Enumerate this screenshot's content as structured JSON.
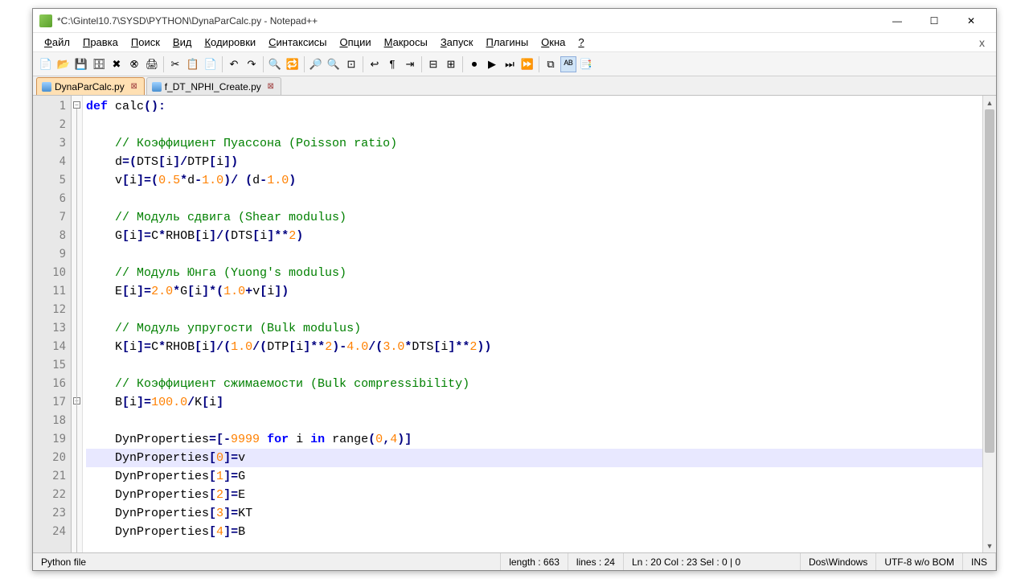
{
  "title": "*C:\\Gintel10.7\\SYSD\\PYTHON\\DynaParCalc.py - Notepad++",
  "menu": [
    "Файл",
    "Правка",
    "Поиск",
    "Вид",
    "Кодировки",
    "Синтаксисы",
    "Опции",
    "Макросы",
    "Запуск",
    "Плагины",
    "Окна",
    "?"
  ],
  "tabs": [
    {
      "name": "DynaParCalc.py",
      "active": true
    },
    {
      "name": "f_DT_NPHI_Create.py",
      "active": false
    }
  ],
  "gutter_lines": 24,
  "current_line_idx": 19,
  "status": {
    "filetype": "Python file",
    "length": "length : 663",
    "lines": "lines : 24",
    "pos": "Ln : 20    Col : 23    Sel : 0 | 0",
    "eol": "Dos\\Windows",
    "enc": "UTF-8 w/o BOM",
    "ovr": "INS"
  },
  "code": [
    {
      "t": "def",
      "h": [
        [
          "kw",
          "def "
        ],
        [
          "fn",
          "calc"
        ],
        [
          "op",
          "():"
        ]
      ]
    },
    {
      "t": ""
    },
    {
      "t": "c",
      "h": [
        [
          "id",
          "    "
        ],
        [
          "cm",
          "// Коэффициент Пуассона (Poisson ratio)"
        ]
      ]
    },
    {
      "t": "",
      "h": [
        [
          "id",
          "    d"
        ],
        [
          "op",
          "=("
        ],
        [
          "id",
          "DTS"
        ],
        [
          "op",
          "["
        ],
        [
          "id",
          "i"
        ],
        [
          "op",
          "]/"
        ],
        [
          "id",
          "DTP"
        ],
        [
          "op",
          "["
        ],
        [
          "id",
          "i"
        ],
        [
          "op",
          "])"
        ]
      ]
    },
    {
      "t": "",
      "h": [
        [
          "id",
          "    v"
        ],
        [
          "op",
          "["
        ],
        [
          "id",
          "i"
        ],
        [
          "op",
          "]=("
        ],
        [
          "num",
          "0.5"
        ],
        [
          "op",
          "*"
        ],
        [
          "id",
          "d"
        ],
        [
          "op",
          "-"
        ],
        [
          "num",
          "1.0"
        ],
        [
          "op",
          ")/ ("
        ],
        [
          "id",
          "d"
        ],
        [
          "op",
          "-"
        ],
        [
          "num",
          "1.0"
        ],
        [
          "op",
          ")"
        ]
      ]
    },
    {
      "t": ""
    },
    {
      "t": "c",
      "h": [
        [
          "id",
          "    "
        ],
        [
          "cm",
          "// Модуль сдвига (Shear modulus)"
        ]
      ]
    },
    {
      "t": "",
      "h": [
        [
          "id",
          "    G"
        ],
        [
          "op",
          "["
        ],
        [
          "id",
          "i"
        ],
        [
          "op",
          "]="
        ],
        [
          "id",
          "C"
        ],
        [
          "op",
          "*"
        ],
        [
          "id",
          "RHOB"
        ],
        [
          "op",
          "["
        ],
        [
          "id",
          "i"
        ],
        [
          "op",
          "]/("
        ],
        [
          "id",
          "DTS"
        ],
        [
          "op",
          "["
        ],
        [
          "id",
          "i"
        ],
        [
          "op",
          "]**"
        ],
        [
          "num",
          "2"
        ],
        [
          "op",
          ")"
        ]
      ]
    },
    {
      "t": ""
    },
    {
      "t": "c",
      "h": [
        [
          "id",
          "    "
        ],
        [
          "cm",
          "// Модуль Юнга (Yuong's modulus)"
        ]
      ]
    },
    {
      "t": "",
      "h": [
        [
          "id",
          "    E"
        ],
        [
          "op",
          "["
        ],
        [
          "id",
          "i"
        ],
        [
          "op",
          "]="
        ],
        [
          "num",
          "2.0"
        ],
        [
          "op",
          "*"
        ],
        [
          "id",
          "G"
        ],
        [
          "op",
          "["
        ],
        [
          "id",
          "i"
        ],
        [
          "op",
          "]*("
        ],
        [
          "num",
          "1.0"
        ],
        [
          "op",
          "+"
        ],
        [
          "id",
          "v"
        ],
        [
          "op",
          "["
        ],
        [
          "id",
          "i"
        ],
        [
          "op",
          "])"
        ]
      ]
    },
    {
      "t": ""
    },
    {
      "t": "c",
      "h": [
        [
          "id",
          "    "
        ],
        [
          "cm",
          "// Модуль упругости (Bulk modulus)"
        ]
      ]
    },
    {
      "t": "",
      "h": [
        [
          "id",
          "    K"
        ],
        [
          "op",
          "["
        ],
        [
          "id",
          "i"
        ],
        [
          "op",
          "]="
        ],
        [
          "id",
          "C"
        ],
        [
          "op",
          "*"
        ],
        [
          "id",
          "RHOB"
        ],
        [
          "op",
          "["
        ],
        [
          "id",
          "i"
        ],
        [
          "op",
          "]/("
        ],
        [
          "num",
          "1.0"
        ],
        [
          "op",
          "/("
        ],
        [
          "id",
          "DTP"
        ],
        [
          "op",
          "["
        ],
        [
          "id",
          "i"
        ],
        [
          "op",
          "]**"
        ],
        [
          "num",
          "2"
        ],
        [
          "op",
          ")-"
        ],
        [
          "num",
          "4.0"
        ],
        [
          "op",
          "/("
        ],
        [
          "num",
          "3.0"
        ],
        [
          "op",
          "*"
        ],
        [
          "id",
          "DTS"
        ],
        [
          "op",
          "["
        ],
        [
          "id",
          "i"
        ],
        [
          "op",
          "]**"
        ],
        [
          "num",
          "2"
        ],
        [
          "op",
          "))"
        ]
      ]
    },
    {
      "t": ""
    },
    {
      "t": "c",
      "h": [
        [
          "id",
          "    "
        ],
        [
          "cm",
          "// Коэффициент сжимаемости (Bulk compressibility)"
        ]
      ]
    },
    {
      "t": "",
      "h": [
        [
          "id",
          "    B"
        ],
        [
          "op",
          "["
        ],
        [
          "id",
          "i"
        ],
        [
          "op",
          "]="
        ],
        [
          "num",
          "100.0"
        ],
        [
          "op",
          "/"
        ],
        [
          "id",
          "K"
        ],
        [
          "op",
          "["
        ],
        [
          "id",
          "i"
        ],
        [
          "op",
          "]"
        ]
      ]
    },
    {
      "t": ""
    },
    {
      "t": "",
      "h": [
        [
          "id",
          "    DynProperties"
        ],
        [
          "op",
          "=[-"
        ],
        [
          "num",
          "9999"
        ],
        [
          "id",
          " "
        ],
        [
          "kw",
          "for"
        ],
        [
          "id",
          " i "
        ],
        [
          "kw",
          "in"
        ],
        [
          "id",
          " "
        ],
        [
          "fn",
          "range"
        ],
        [
          "op",
          "("
        ],
        [
          "num",
          "0"
        ],
        [
          "op",
          ","
        ],
        [
          "num",
          "4"
        ],
        [
          "op",
          ")]"
        ]
      ]
    },
    {
      "t": "",
      "h": [
        [
          "id",
          "    DynProperties"
        ],
        [
          "op",
          "["
        ],
        [
          "num",
          "0"
        ],
        [
          "op",
          "]="
        ],
        [
          "id",
          "v"
        ]
      ]
    },
    {
      "t": "",
      "h": [
        [
          "id",
          "    DynProperties"
        ],
        [
          "op",
          "["
        ],
        [
          "num",
          "1"
        ],
        [
          "op",
          "]="
        ],
        [
          "id",
          "G"
        ]
      ]
    },
    {
      "t": "",
      "h": [
        [
          "id",
          "    DynProperties"
        ],
        [
          "op",
          "["
        ],
        [
          "num",
          "2"
        ],
        [
          "op",
          "]="
        ],
        [
          "id",
          "E"
        ]
      ]
    },
    {
      "t": "",
      "h": [
        [
          "id",
          "    DynProperties"
        ],
        [
          "op",
          "["
        ],
        [
          "num",
          "3"
        ],
        [
          "op",
          "]="
        ],
        [
          "id",
          "KT"
        ]
      ]
    },
    {
      "t": "",
      "h": [
        [
          "id",
          "    DynProperties"
        ],
        [
          "op",
          "["
        ],
        [
          "num",
          "4"
        ],
        [
          "op",
          "]="
        ],
        [
          "id",
          "B"
        ]
      ]
    }
  ],
  "toolbar_icons": [
    "new",
    "open",
    "save",
    "saveall",
    "close",
    "closeall",
    "print",
    "|",
    "cut",
    "copy",
    "paste",
    "|",
    "undo",
    "redo",
    "|",
    "find",
    "replace",
    "|",
    "zoomin",
    "zoomout",
    "fit",
    "|",
    "wrap",
    "allchars",
    "indent",
    "|",
    "fold",
    "unfold",
    "|",
    "rec",
    "play",
    "playall",
    "fwd",
    "|",
    "compare",
    "spell",
    "doc"
  ]
}
